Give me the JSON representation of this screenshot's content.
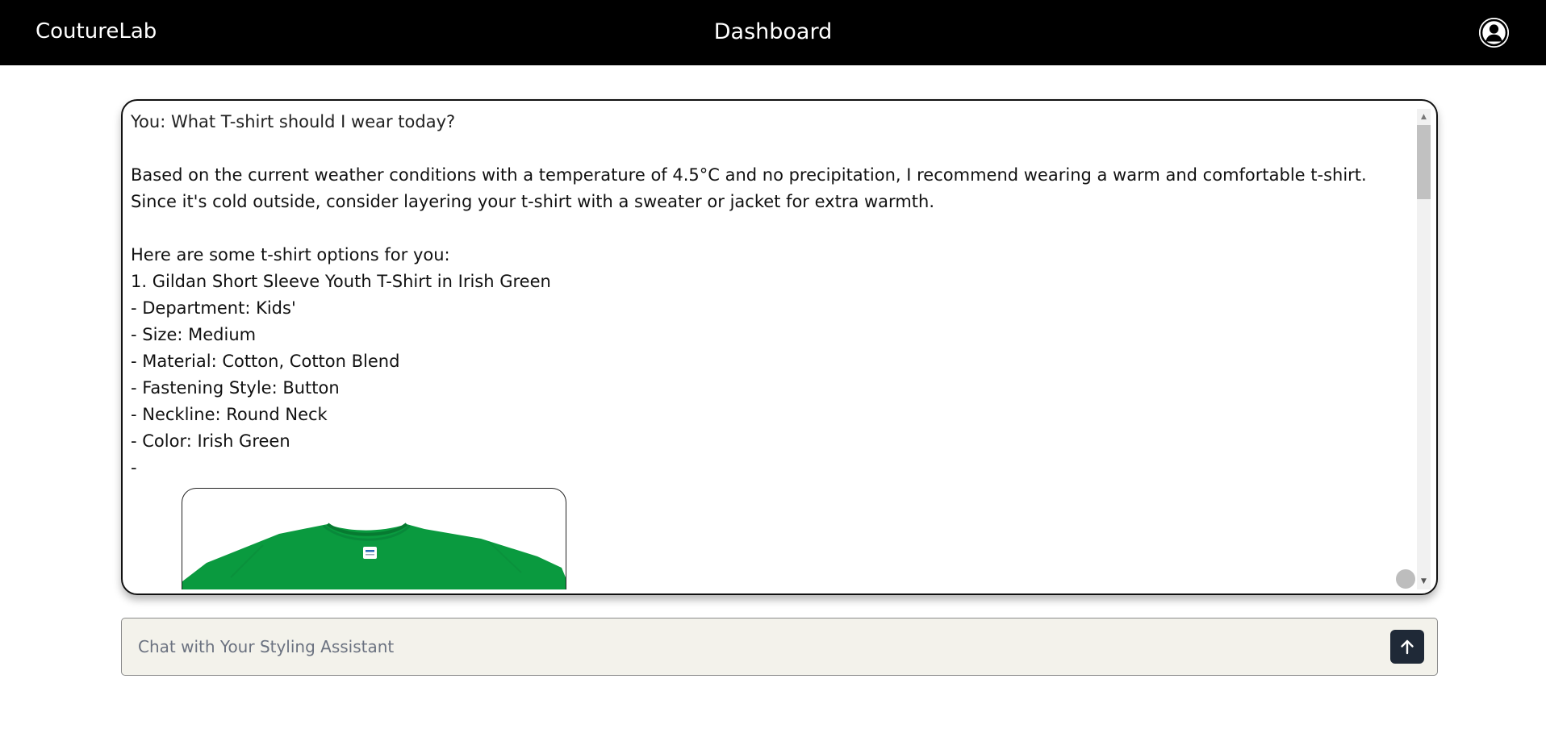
{
  "header": {
    "brand": "CoutureLab",
    "title": "Dashboard",
    "user_icon": "user-circle-icon"
  },
  "chat": {
    "user_message": "You: What T-shirt should I wear today?",
    "assistant": {
      "intro_lines": [
        "Based on the current weather conditions with a temperature of 4.5°C and no precipitation, I recommend wearing a warm and comfortable t-shirt.",
        "Since it's cold outside, consider layering your t-shirt with a sweater or jacket for extra warmth."
      ],
      "options_heading": "Here are some t-shirt options for you:",
      "product": {
        "name_line": "1. Gildan Short Sleeve Youth T-Shirt in Irish Green",
        "details": [
          "- Department: Kids'",
          "- Size: Medium",
          "- Material: Cotton, Cotton Blend",
          "- Fastening Style: Button",
          "- Neckline: Round Neck",
          "- Color: Irish Green",
          "-"
        ],
        "image_color": "#0a9a3f"
      }
    }
  },
  "composer": {
    "placeholder": "Chat with Your Styling Assistant",
    "value": "",
    "send_icon": "arrow-up-icon"
  },
  "colors": {
    "header_bg": "#000000",
    "input_bg": "#f3f2eb",
    "send_button_bg": "#1f2937"
  }
}
